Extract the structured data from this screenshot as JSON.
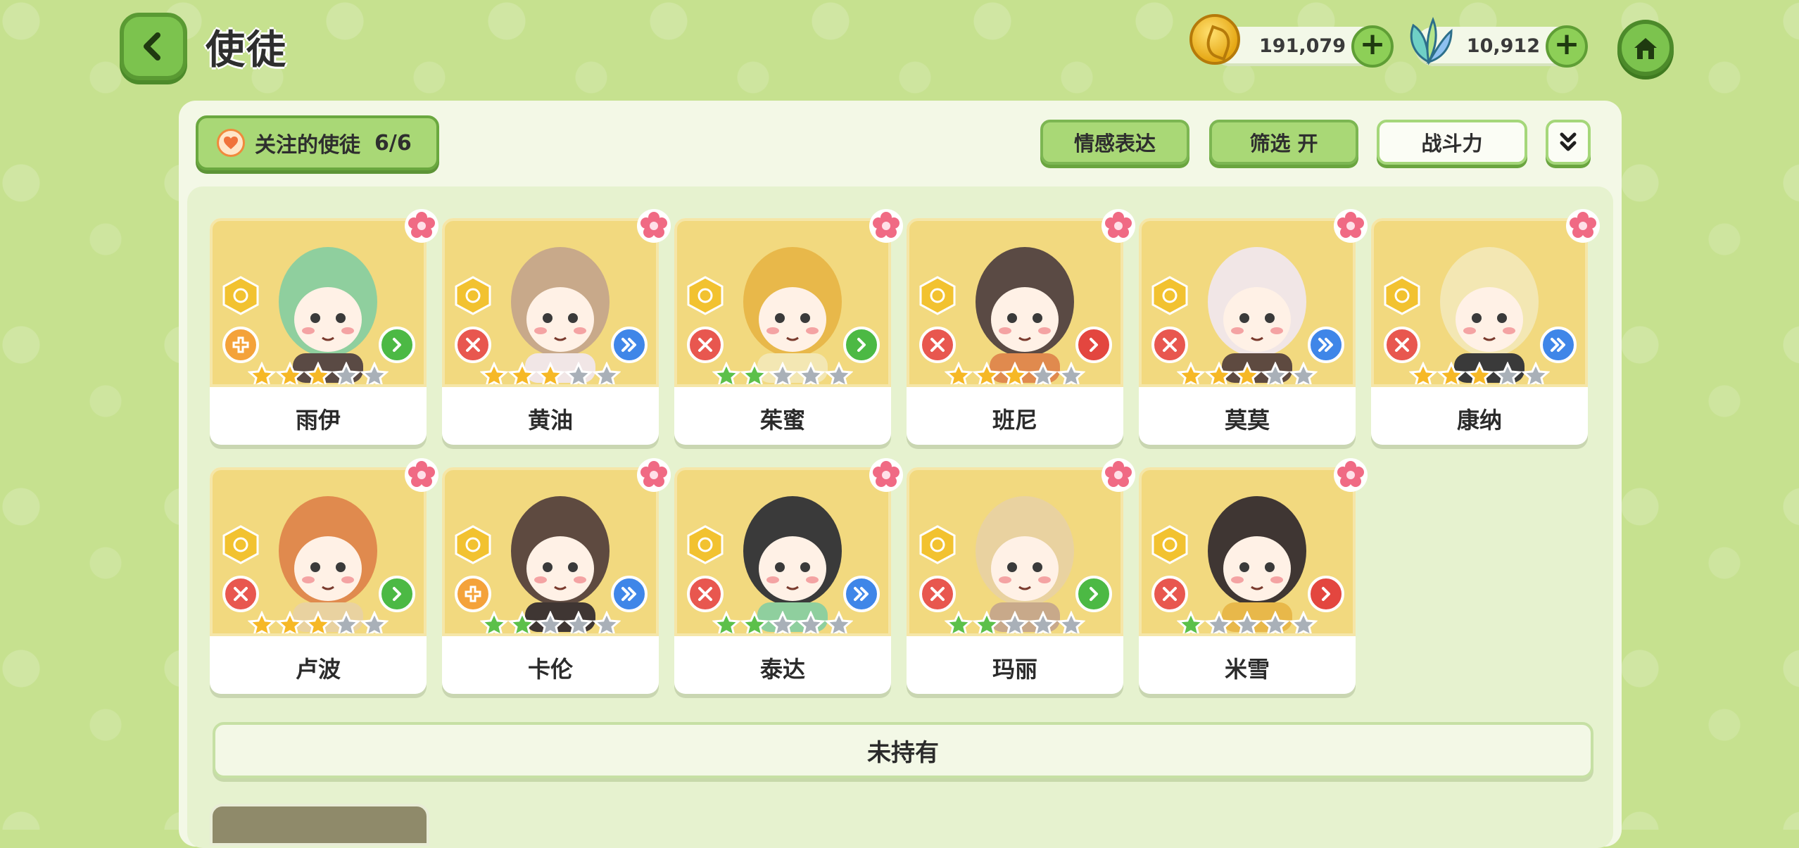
{
  "header": {
    "title": "使徒",
    "gold_amount": "191,079",
    "leaf_amount": "10,912",
    "plus_label": "+"
  },
  "toolbar": {
    "follow_label": "关注的使徒",
    "follow_count": "6/6",
    "emotion_label": "情感表达",
    "filter_label": "筛选 开",
    "power_label": "战斗力"
  },
  "apostles": [
    {
      "name": "雨伊",
      "stars": 3,
      "star_color": "gold",
      "role_icon": "cross-icon",
      "role_color": "orange",
      "dir_color": "green"
    },
    {
      "name": "黄油",
      "stars": 3,
      "star_color": "gold",
      "role_icon": "tools-icon",
      "role_color": "red",
      "dir_color": "blue"
    },
    {
      "name": "茱蜜",
      "stars": 2,
      "star_color": "green",
      "role_icon": "tools-icon",
      "role_color": "red",
      "dir_color": "green"
    },
    {
      "name": "班尼",
      "stars": 3,
      "star_color": "gold",
      "role_icon": "tools-icon",
      "role_color": "red",
      "dir_color": "red"
    },
    {
      "name": "莫莫",
      "stars": 3,
      "star_color": "gold",
      "role_icon": "tools-icon",
      "role_color": "red",
      "dir_color": "blue"
    },
    {
      "name": "康纳",
      "stars": 3,
      "star_color": "gold",
      "role_icon": "tools-icon",
      "role_color": "red",
      "dir_color": "blue"
    },
    {
      "name": "卢波",
      "stars": 3,
      "star_color": "gold",
      "role_icon": "tools-icon",
      "role_color": "red",
      "dir_color": "green"
    },
    {
      "name": "卡伦",
      "stars": 2,
      "star_color": "green",
      "role_icon": "cross-icon",
      "role_color": "orange",
      "dir_color": "blue"
    },
    {
      "name": "泰达",
      "stars": 2,
      "star_color": "green",
      "role_icon": "tools-icon",
      "role_color": "red",
      "dir_color": "blue"
    },
    {
      "name": "玛丽",
      "stars": 2,
      "star_color": "green",
      "role_icon": "tools-icon",
      "role_color": "red",
      "dir_color": "green"
    },
    {
      "name": "米雪",
      "stars": 1,
      "star_color": "green",
      "role_icon": "tools-icon",
      "role_color": "red",
      "dir_color": "red"
    }
  ],
  "section": {
    "not_owned_label": "未持有"
  },
  "colors": {
    "background": "#c6e18f",
    "accent_green": "#7cc34e",
    "card_art": "#f2d97f",
    "star_gold": "#f6b826",
    "star_green": "#5cc04a",
    "star_gray": "#a9b0b8"
  }
}
